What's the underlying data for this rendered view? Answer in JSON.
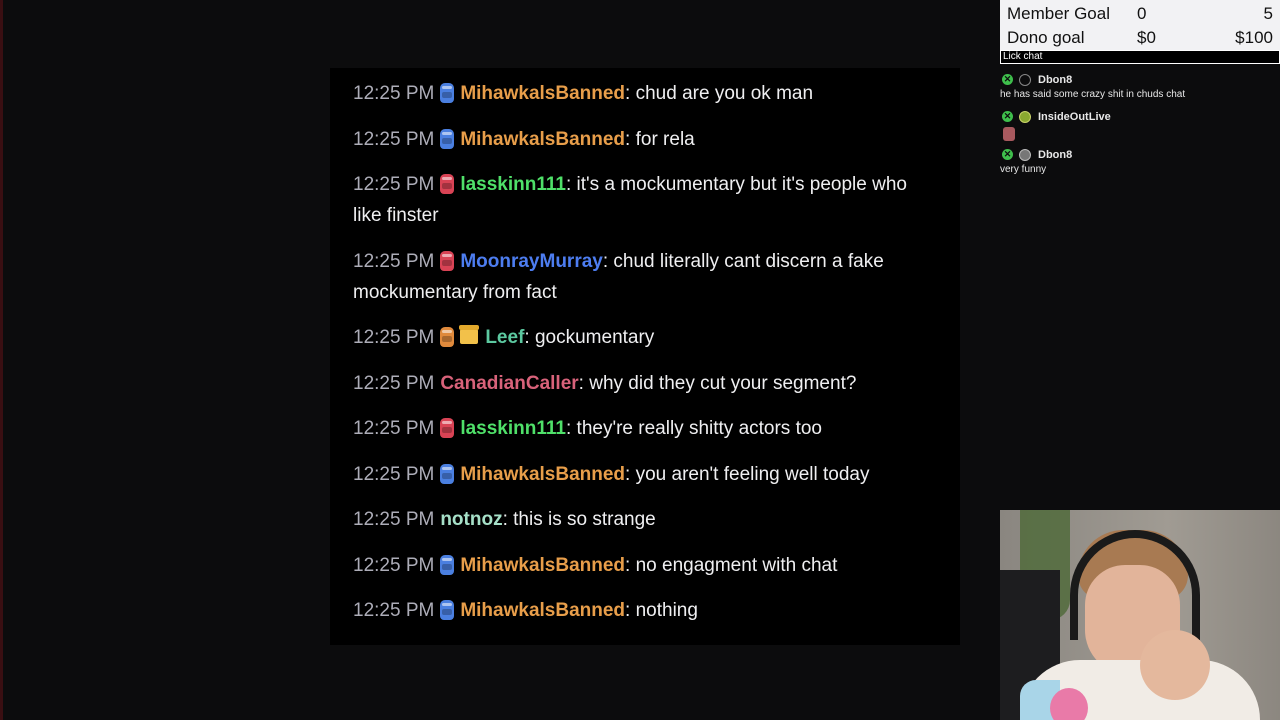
{
  "goals": {
    "member": {
      "label": "Member Goal",
      "current": "0",
      "target": "5"
    },
    "dono": {
      "label": "Dono goal",
      "current": "$0",
      "target": "$100"
    }
  },
  "overlay_label": "Lick chat",
  "mini_chat": [
    {
      "user": "Dbon8",
      "text": "he has said some crazy shit in chuds chat"
    },
    {
      "user": "InsideOutLive",
      "text": ""
    },
    {
      "user": "Dbon8",
      "text": "very funny"
    }
  ],
  "chat": [
    {
      "time": "12:25 PM",
      "user": "MihawkalsBanned",
      "sep": ": ",
      "text": "chud are you ok man"
    },
    {
      "time": "12:25 PM",
      "user": "MihawkalsBanned",
      "sep": ": ",
      "text": "for rela"
    },
    {
      "time": "12:25 PM",
      "user": "lasskinn111",
      "sep": ": ",
      "text": "it's a mockumentary but it's people who like finster"
    },
    {
      "time": "12:25 PM",
      "user": "MoonrayMurray",
      "sep": ": ",
      "text": "chud literally cant discern a fake mockumentary from fact"
    },
    {
      "time": "12:25 PM",
      "user": "Leef",
      "sep": ": ",
      "text": "gockumentary"
    },
    {
      "time": "12:25 PM",
      "user": "CanadianCaller",
      "sep": ": ",
      "text": "why did they cut your segment?"
    },
    {
      "time": "12:25 PM",
      "user": "lasskinn111",
      "sep": ": ",
      "text": "they're really shitty actors too"
    },
    {
      "time": "12:25 PM",
      "user": "MihawkalsBanned",
      "sep": ": ",
      "text": "you aren't feeling well today"
    },
    {
      "time": "12:25 PM",
      "user": "notnoz",
      "sep": ": ",
      "text": "this is so strange"
    },
    {
      "time": "12:25 PM",
      "user": "MihawkalsBanned",
      "sep": ": ",
      "text": "no engagment with chat"
    },
    {
      "time": "12:25 PM",
      "user": "MihawkalsBanned",
      "sep": ": ",
      "text": "nothing"
    }
  ]
}
